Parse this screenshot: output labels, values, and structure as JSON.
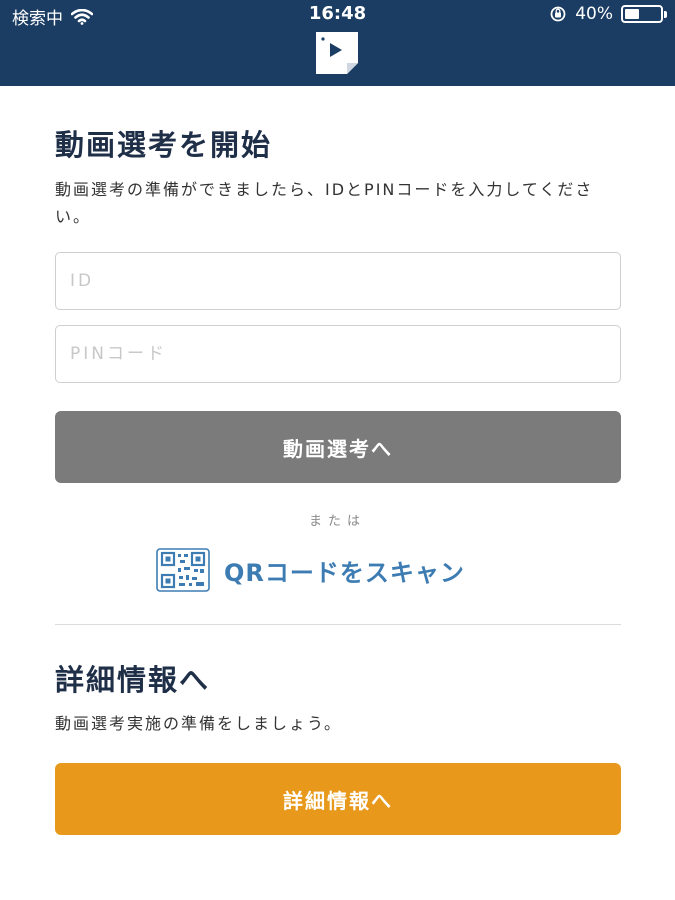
{
  "status_bar": {
    "carrier": "検索中",
    "time": "16:48",
    "battery_percent": "40%",
    "battery_level": 0.4,
    "icons": [
      "wifi-icon",
      "orientation-lock-icon",
      "battery-icon"
    ]
  },
  "header": {
    "logo_icon": "video-document-logo-icon",
    "background_color": "#1b3d63"
  },
  "start_section": {
    "title": "動画選考を開始",
    "description": "動画選考の準備ができましたら、IDとPINコードを入力してください。",
    "id_field": {
      "placeholder": "ID",
      "value": ""
    },
    "pin_field": {
      "placeholder": "PINコード",
      "value": ""
    },
    "start_button_label": "動画選考へ",
    "start_button_color": "#7b7b7b",
    "or_text": "または",
    "qr_link_label": "QRコードをスキャン",
    "qr_icon": "qr-code-icon",
    "link_color": "#3d7cb3"
  },
  "details_section": {
    "title": "詳細情報へ",
    "description": "動画選考実施の準備をしましょう。",
    "button_label": "詳細情報へ",
    "button_color": "#e8981a"
  }
}
